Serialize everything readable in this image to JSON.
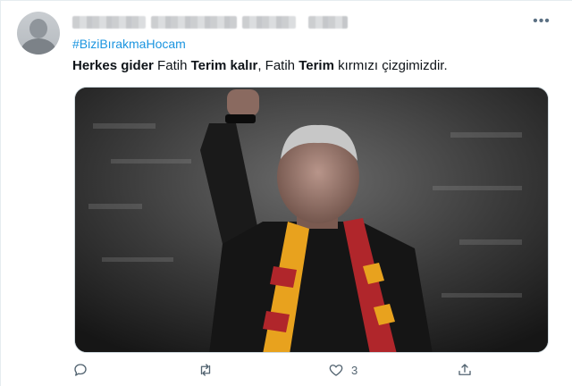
{
  "tweet": {
    "hashtag": "#BiziBırakmaHocam",
    "text_parts": [
      {
        "text": "Herkes gider",
        "bold": true
      },
      {
        "text": " Fatih ",
        "bold": false
      },
      {
        "text": "Terim kalır",
        "bold": true
      },
      {
        "text": ", Fatih ",
        "bold": false
      },
      {
        "text": "Terim",
        "bold": true
      },
      {
        "text": " kırmızı çizgimizdir.",
        "bold": false
      }
    ],
    "like_count": "3"
  },
  "icons": {
    "reply": "reply-icon",
    "retweet": "retweet-icon",
    "like": "heart-icon",
    "share": "share-icon",
    "more": "more-icon"
  },
  "colors": {
    "link": "#1b95e0",
    "icon": "#536471",
    "scarf_red": "#b0262b",
    "scarf_yellow": "#e8a21e"
  }
}
